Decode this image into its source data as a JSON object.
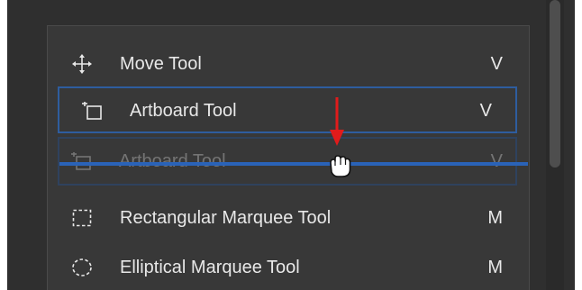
{
  "tool_menu": {
    "items": [
      {
        "label": "Move Tool",
        "shortcut": "V",
        "icon": "move-icon"
      },
      {
        "label": "Artboard Tool",
        "shortcut": "V",
        "icon": "artboard-icon",
        "selected": true
      },
      {
        "label": "Artboard Tool",
        "shortcut": "V",
        "icon": "artboard-icon",
        "dragging": true
      },
      {
        "label": "Rectangular Marquee Tool",
        "shortcut": "M",
        "icon": "rectangular-marquee-icon"
      },
      {
        "label": "Elliptical Marquee Tool",
        "shortcut": "M",
        "icon": "elliptical-marquee-icon"
      }
    ]
  },
  "colors": {
    "background": "#2f2f2f",
    "panel": "#383838",
    "text": "#e8e8e8",
    "selection": "#2e5d9f",
    "drop_indicator": "#2a63b8",
    "annotation_arrow": "#e11b1b"
  },
  "cursor": "grab-hand-icon"
}
